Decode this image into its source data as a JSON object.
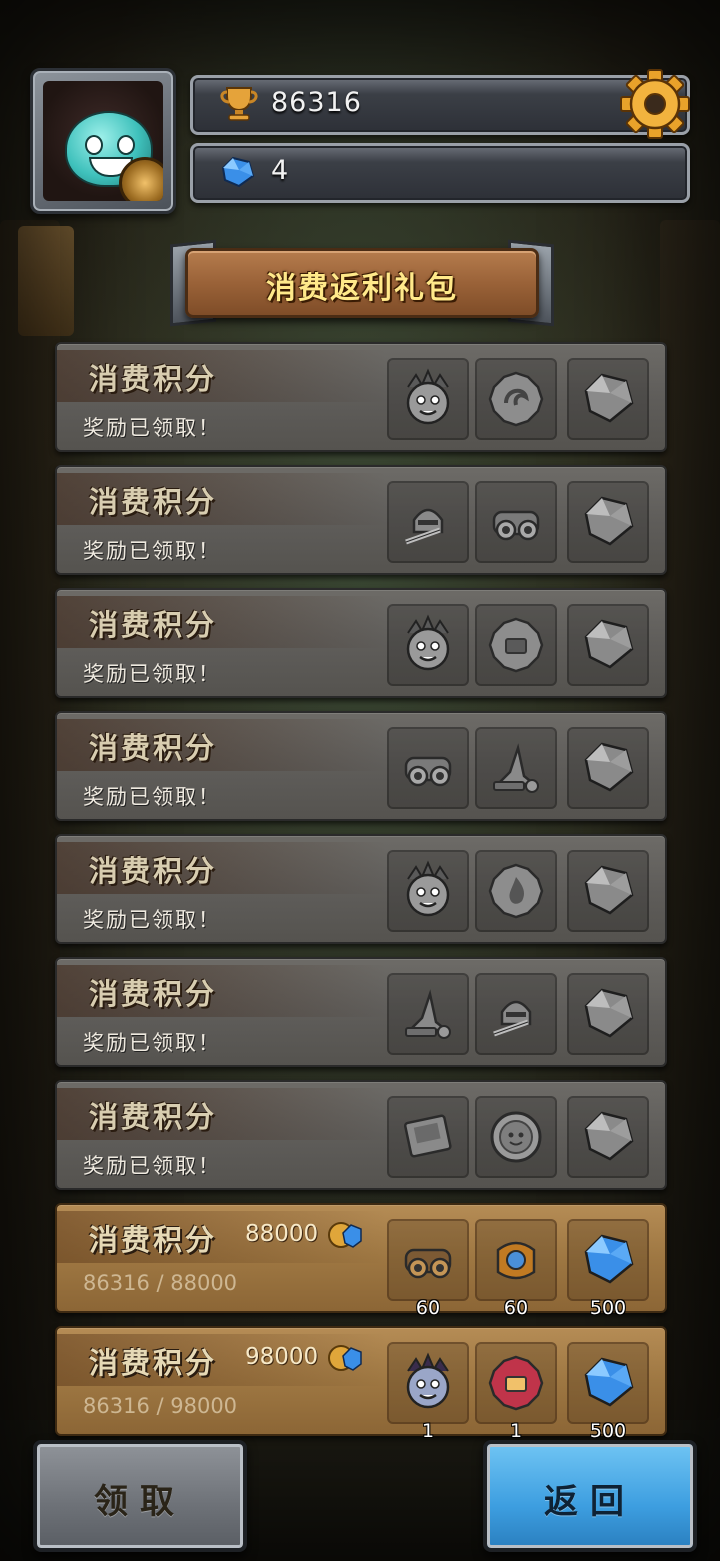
{
  "header": {
    "trophy_count": "86316",
    "gem_count": "4"
  },
  "title": "消费返利礼包",
  "rows": [
    {
      "state": "done",
      "title": "消费积分",
      "status": "奖励已领取！",
      "rewards": [
        {
          "icon": "knight-hero-icon"
        },
        {
          "icon": "horn-badge-icon"
        },
        {
          "icon": "gem-icon"
        }
      ]
    },
    {
      "state": "done",
      "title": "消费积分",
      "status": "奖励已领取！",
      "rewards": [
        {
          "icon": "sword-helmet-icon"
        },
        {
          "icon": "goggles-gear-icon"
        },
        {
          "icon": "gem-icon"
        }
      ]
    },
    {
      "state": "done",
      "title": "消费积分",
      "status": "奖励已领取！",
      "rewards": [
        {
          "icon": "monster-hero-icon"
        },
        {
          "icon": "rune-badge-icon"
        },
        {
          "icon": "gem-icon"
        }
      ]
    },
    {
      "state": "done",
      "title": "消费积分",
      "status": "奖励已领取！",
      "rewards": [
        {
          "icon": "goggles-gear-icon"
        },
        {
          "icon": "wizard-hat-icon"
        },
        {
          "icon": "gem-icon"
        }
      ]
    },
    {
      "state": "done",
      "title": "消费积分",
      "status": "奖励已领取！",
      "rewards": [
        {
          "icon": "plant-hero-icon"
        },
        {
          "icon": "fire-badge-icon"
        },
        {
          "icon": "gem-icon"
        }
      ]
    },
    {
      "state": "done",
      "title": "消费积分",
      "status": "奖励已领取！",
      "rewards": [
        {
          "icon": "wizard-hat-icon"
        },
        {
          "icon": "sword-helmet-icon"
        },
        {
          "icon": "gem-icon"
        }
      ]
    },
    {
      "state": "done",
      "title": "消费积分",
      "status": "奖励已领取！",
      "rewards": [
        {
          "icon": "book-card-icon"
        },
        {
          "icon": "coin-face-icon"
        },
        {
          "icon": "gem-icon"
        }
      ]
    },
    {
      "state": "active",
      "title": "消费积分",
      "points": "88000",
      "progress": "86316 / 88000",
      "rewards": [
        {
          "icon": "goggles-gear-icon",
          "qty": "60"
        },
        {
          "icon": "armor-gear-icon",
          "qty": "60"
        },
        {
          "icon": "gem-icon",
          "qty": "500"
        }
      ]
    },
    {
      "state": "active",
      "title": "消费积分",
      "points": "98000",
      "progress": "86316 / 98000",
      "rewards": [
        {
          "icon": "demon-hero-icon",
          "qty": "1"
        },
        {
          "icon": "rune-badge-icon",
          "qty": "1"
        },
        {
          "icon": "gem-icon",
          "qty": "500"
        }
      ]
    }
  ],
  "buttons": {
    "claim": "领取",
    "back": "返回"
  },
  "colors": {
    "title_text": "#ffe98a",
    "active_row": "#a97f48",
    "done_row": "#615f5b",
    "back_button": "#3d9ee0",
    "gem": "#3a8fe8"
  }
}
